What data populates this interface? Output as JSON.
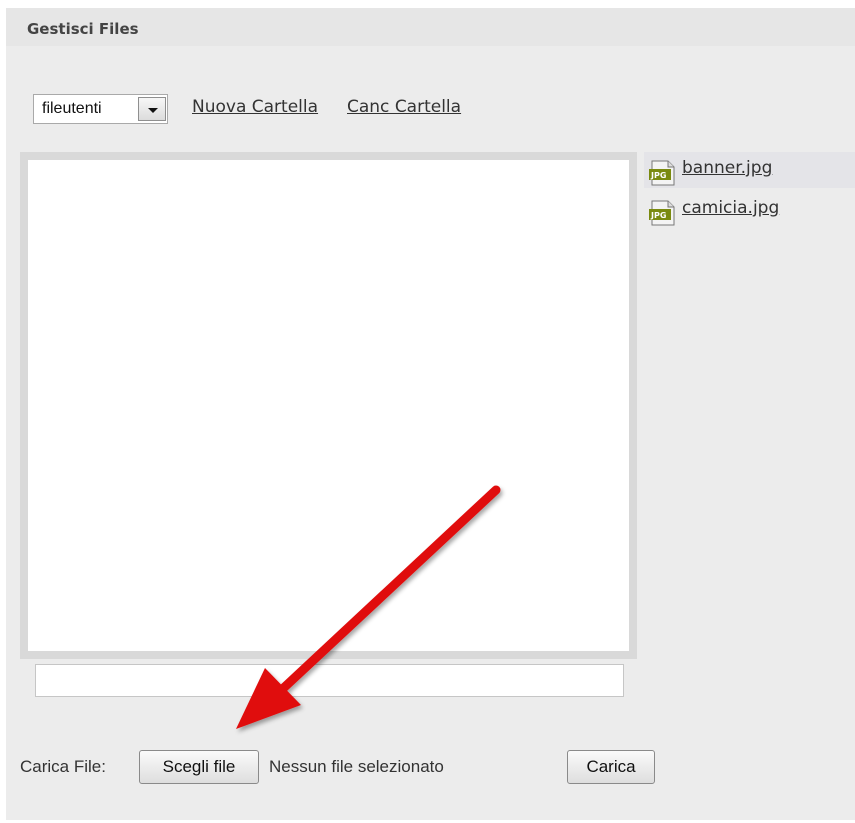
{
  "header": {
    "title": "Gestisci Files"
  },
  "toolbar": {
    "folder_value": "fileutenti",
    "new_folder": "Nuova Cartella",
    "delete_folder": "Canc Cartella"
  },
  "files": [
    {
      "name": "banner.jpg",
      "icon": "jpg-file-icon",
      "selected": true
    },
    {
      "name": "camicia.jpg",
      "icon": "jpg-file-icon",
      "selected": false
    }
  ],
  "upload": {
    "label": "Carica File:",
    "choose_label": "Scegli file",
    "status": "Nessun file selezionato",
    "submit_label": "Carica"
  },
  "colors": {
    "annotation_arrow": "#e01010",
    "panel_background": "#ececec",
    "jpg_icon_green": "#7a8a10"
  }
}
